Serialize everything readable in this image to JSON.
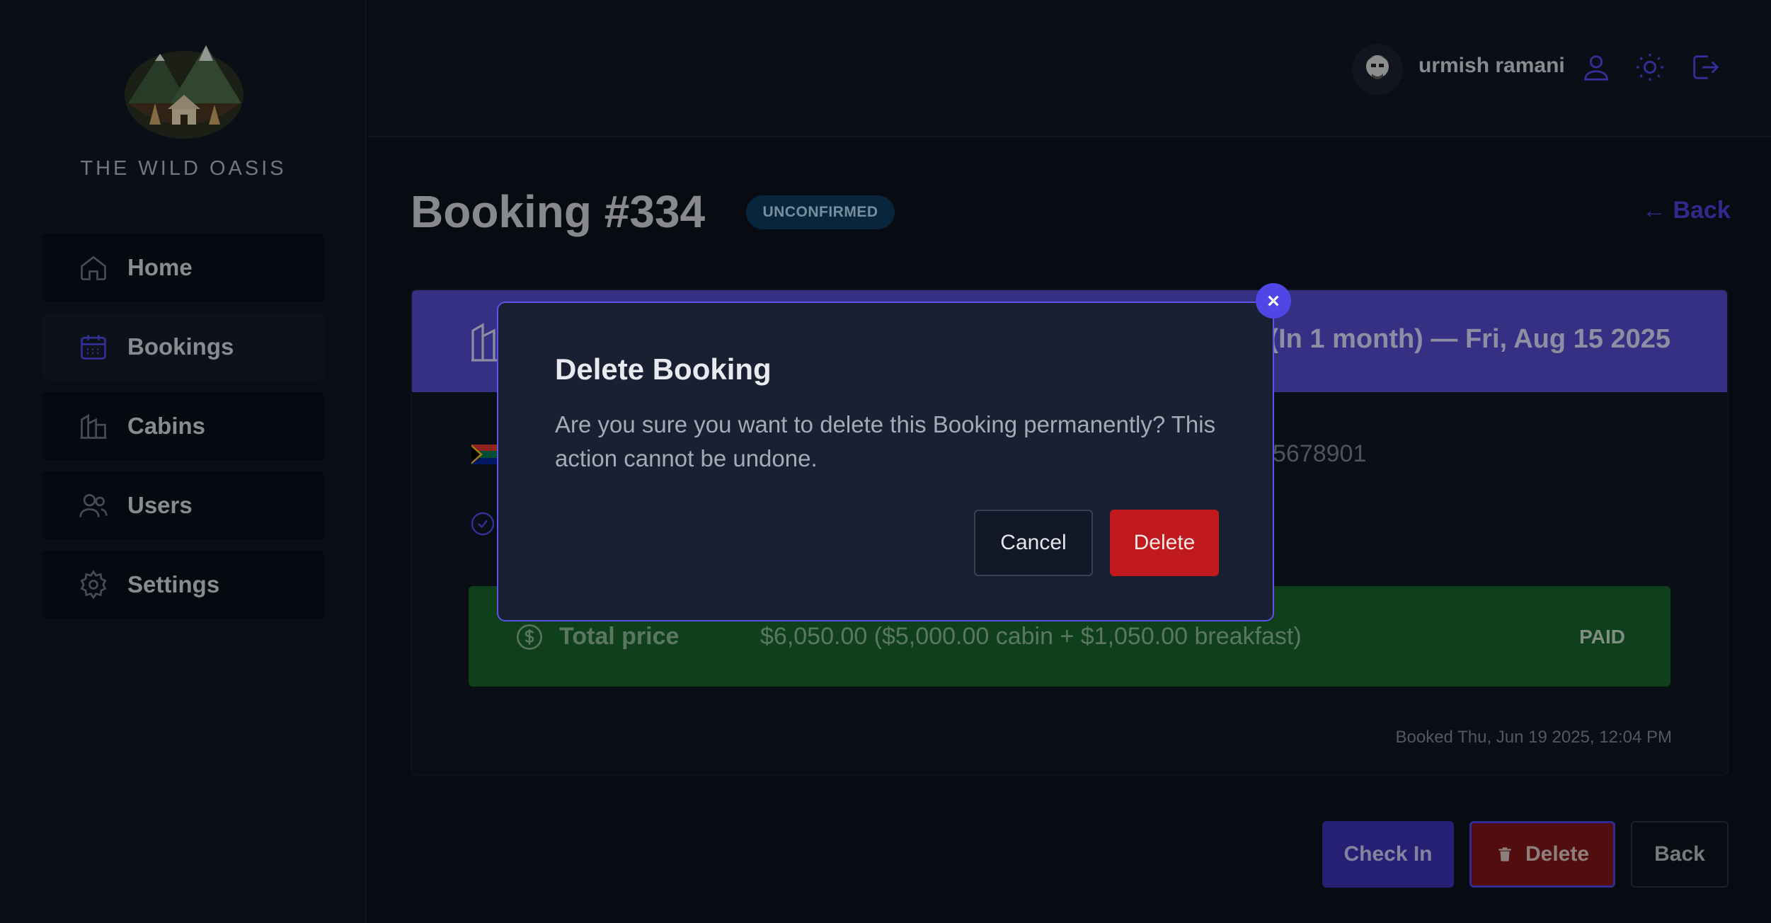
{
  "app": {
    "brand": "THE WILD OASIS"
  },
  "sidebar": {
    "items": [
      {
        "label": "Home",
        "icon": "home-icon"
      },
      {
        "label": "Bookings",
        "icon": "calendar-icon",
        "active": true
      },
      {
        "label": "Cabins",
        "icon": "cabin-icon"
      },
      {
        "label": "Users",
        "icon": "users-icon"
      },
      {
        "label": "Settings",
        "icon": "gear-icon"
      }
    ]
  },
  "header": {
    "username": "urmish ramani",
    "icons": [
      "user-icon",
      "sun-icon",
      "logout-icon"
    ]
  },
  "booking": {
    "title": "Booking #334",
    "status": "UNCONFIRMED",
    "back_link": "← Back",
    "dates_partial": ") (In 1 month) — Fri, Aug 15 2025",
    "phone_partial": "5678901",
    "price_label": "Total price",
    "price_value": "$6,050.00 ($5,000.00 cabin + $1,050.00 breakfast)",
    "paid_status": "PAID",
    "booked_at": "Booked Thu, Jun 19 2025, 12:04 PM"
  },
  "actions": {
    "check_in": "Check In",
    "delete": "Delete",
    "back": "Back"
  },
  "modal": {
    "title": "Delete Booking",
    "message": "Are you sure you want to delete this Booking permanently? This action cannot be undone.",
    "cancel": "Cancel",
    "confirm": "Delete"
  },
  "colors": {
    "accent": "#4f46e5",
    "danger": "#c0191e",
    "paid_bg": "#17612a",
    "badge_bg": "#0b3a5e"
  }
}
